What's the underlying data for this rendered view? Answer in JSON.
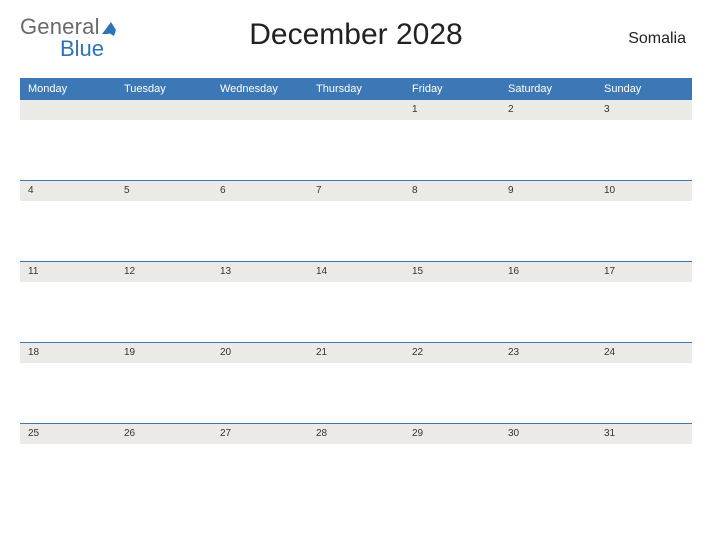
{
  "logo": {
    "line1": "General",
    "line2": "Blue"
  },
  "title": "December 2028",
  "country": "Somalia",
  "daynames": [
    "Monday",
    "Tuesday",
    "Wednesday",
    "Thursday",
    "Friday",
    "Saturday",
    "Sunday"
  ],
  "weeks": [
    [
      "",
      "",
      "",
      "",
      "1",
      "2",
      "3"
    ],
    [
      "4",
      "5",
      "6",
      "7",
      "8",
      "9",
      "10"
    ],
    [
      "11",
      "12",
      "13",
      "14",
      "15",
      "16",
      "17"
    ],
    [
      "18",
      "19",
      "20",
      "21",
      "22",
      "23",
      "24"
    ],
    [
      "25",
      "26",
      "27",
      "28",
      "29",
      "30",
      "31"
    ]
  ]
}
